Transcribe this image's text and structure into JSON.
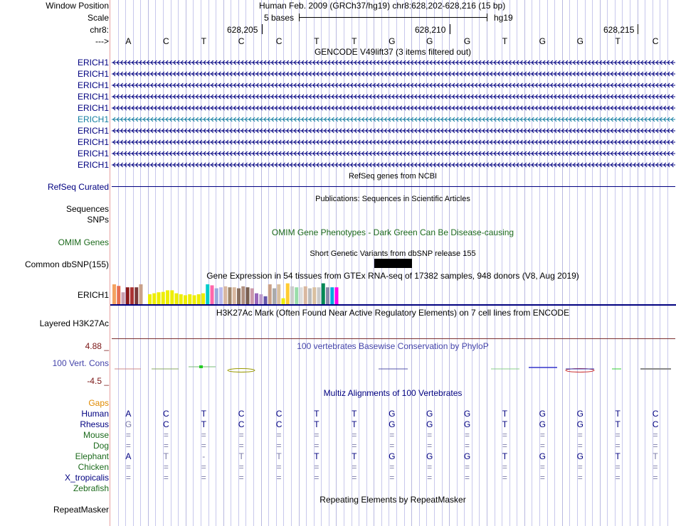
{
  "header": {
    "window_position_label": "Window Position",
    "window_position_value": "Human Feb. 2009 (GRCh37/hg19)   chr8:628,202-628,216 (15 bp)",
    "scale_label": "Scale",
    "scale_bases": "5 bases",
    "scale_assembly": "hg19",
    "chrom_label": "chr8:",
    "arrow_label": "--->",
    "positions": [
      "628,205",
      "628,210",
      "628,215"
    ]
  },
  "sequence": [
    "A",
    "C",
    "T",
    "C",
    "C",
    "T",
    "T",
    "G",
    "G",
    "G",
    "T",
    "G",
    "G",
    "T",
    "C"
  ],
  "gencode": {
    "title": "GENCODE V49lift37 (3 items filtered out)",
    "items": [
      {
        "label": "ERICH1",
        "highlight": false
      },
      {
        "label": "ERICH1",
        "highlight": false
      },
      {
        "label": "ERICH1",
        "highlight": false
      },
      {
        "label": "ERICH1",
        "highlight": false
      },
      {
        "label": "ERICH1",
        "highlight": false
      },
      {
        "label": "ERICH1",
        "highlight": true
      },
      {
        "label": "ERICH1",
        "highlight": false
      },
      {
        "label": "ERICH1",
        "highlight": false
      },
      {
        "label": "ERICH1",
        "highlight": false
      },
      {
        "label": "ERICH1",
        "highlight": false
      }
    ]
  },
  "refseq": {
    "title": "RefSeq genes from NCBI",
    "label": "RefSeq Curated"
  },
  "publications": {
    "title": "Publications: Sequences in Scientific Articles",
    "label1": "Sequences",
    "label2": "SNPs"
  },
  "omim": {
    "title": "OMIM Gene Phenotypes - Dark Green Can Be Disease-causing",
    "label": "OMIM Genes"
  },
  "dbsnp": {
    "title": "Short Genetic Variants from dbSNP release 155",
    "label": "Common dbSNP(155)"
  },
  "gtex": {
    "title": "Gene Expression in 54 tissues from GTEx RNA-seq of 17382 samples, 948 donors (V8, Aug 2019)",
    "label": "ERICH1",
    "bars": [
      {
        "color": "#f4a261",
        "level": 1.0
      },
      {
        "color": "#e76f51",
        "level": 0.92
      },
      {
        "color": "#c9a0b0",
        "level": 0.6
      },
      {
        "color": "#8b1a1a",
        "level": 0.85
      },
      {
        "color": "#aa3333",
        "level": 0.85
      },
      {
        "color": "#7b3a3a",
        "level": 0.85
      },
      {
        "color": "#c9a089",
        "level": 1.0
      },
      {
        "color": "#ffffff",
        "level": 0.1
      },
      {
        "color": "#eeee00",
        "level": 0.5
      },
      {
        "color": "#eeee00",
        "level": 0.55
      },
      {
        "color": "#eeee00",
        "level": 0.6
      },
      {
        "color": "#eeee00",
        "level": 0.62
      },
      {
        "color": "#eeee00",
        "level": 0.7
      },
      {
        "color": "#eeee00",
        "level": 0.7
      },
      {
        "color": "#eeee00",
        "level": 0.55
      },
      {
        "color": "#eeee00",
        "level": 0.5
      },
      {
        "color": "#eeee00",
        "level": 0.45
      },
      {
        "color": "#eeee00",
        "level": 0.5
      },
      {
        "color": "#eeee00",
        "level": 0.45
      },
      {
        "color": "#eeee00",
        "level": 0.5
      },
      {
        "color": "#eeee00",
        "level": 0.55
      },
      {
        "color": "#00cccc",
        "level": 1.0
      },
      {
        "color": "#ff66aa",
        "level": 0.95
      },
      {
        "color": "#99aadd",
        "level": 0.8
      },
      {
        "color": "#bbbbee",
        "level": 0.85
      },
      {
        "color": "#d9b8a0",
        "level": 0.9
      },
      {
        "color": "#a0866a",
        "level": 0.85
      },
      {
        "color": "#d9b8a0",
        "level": 0.85
      },
      {
        "color": "#8a7060",
        "level": 0.8
      },
      {
        "color": "#b09080",
        "level": 0.9
      },
      {
        "color": "#7a6050",
        "level": 0.85
      },
      {
        "color": "#cc99aa",
        "level": 0.8
      },
      {
        "color": "#9966bb",
        "level": 0.55
      },
      {
        "color": "#bb99cc",
        "level": 0.5
      },
      {
        "color": "#6655aa",
        "level": 0.4
      },
      {
        "color": "#c9a089",
        "level": 1.0
      },
      {
        "color": "#aaaaaa",
        "level": 0.8
      },
      {
        "color": "#d9c0a0",
        "level": 1.0
      },
      {
        "color": "#eeee00",
        "level": 0.3
      },
      {
        "color": "#ffcc33",
        "level": 1.05
      },
      {
        "color": "#cccccc",
        "level": 0.9
      },
      {
        "color": "#99ddaa",
        "level": 0.85
      },
      {
        "color": "#dddddd",
        "level": 0.85
      },
      {
        "color": "#d9b8a0",
        "level": 0.9
      },
      {
        "color": "#bbbbbb",
        "level": 0.8
      },
      {
        "color": "#d9c0a0",
        "level": 0.85
      },
      {
        "color": "#c9c9c9",
        "level": 0.85
      },
      {
        "color": "#008855",
        "level": 1.05
      },
      {
        "color": "#8888aa",
        "level": 0.85
      },
      {
        "color": "#00aadd",
        "level": 0.85
      },
      {
        "color": "#ff00ee",
        "level": 0.85
      }
    ]
  },
  "h3k27ac": {
    "title": "H3K27Ac Mark (Often Found Near Active Regulatory Elements) on 7 cell lines from ENCODE",
    "label": "Layered H3K27Ac"
  },
  "cons": {
    "title": "100 vertebrates Basewise Conservation by PhyloP",
    "label": "100 Vert. Cons",
    "max": "4.88 _",
    "min": "-4.5 _"
  },
  "multiz": {
    "title": "Multiz Alignments of 100 Vertebrates",
    "gaps_label": "Gaps",
    "species": [
      {
        "name": "Human",
        "color": "#000080",
        "bases": [
          "A",
          "C",
          "T",
          "C",
          "C",
          "T",
          "T",
          "G",
          "G",
          "G",
          "T",
          "G",
          "G",
          "T",
          "C"
        ],
        "grey": []
      },
      {
        "name": "Rhesus",
        "color": "#000080",
        "bases": [
          "G",
          "C",
          "T",
          "C",
          "C",
          "T",
          "T",
          "G",
          "G",
          "G",
          "T",
          "G",
          "G",
          "T",
          "C"
        ],
        "grey": [
          0
        ]
      },
      {
        "name": "Mouse",
        "color": "#1c6a1c",
        "bases": [
          "=",
          "=",
          "=",
          "=",
          "=",
          "=",
          "=",
          "=",
          "=",
          "=",
          "=",
          "=",
          "=",
          "=",
          "="
        ],
        "grey": "all"
      },
      {
        "name": "Dog",
        "color": "#1c6a1c",
        "bases": [
          "=",
          "=",
          "=",
          "=",
          "=",
          "=",
          "=",
          "=",
          "=",
          "=",
          "=",
          "=",
          "=",
          "=",
          "="
        ],
        "grey": "all"
      },
      {
        "name": "Elephant",
        "color": "#1c6a1c",
        "bases": [
          "A",
          "T",
          "-",
          "T",
          "T",
          "T",
          "T",
          "G",
          "G",
          "G",
          "T",
          "G",
          "G",
          "T",
          "T"
        ],
        "grey": [
          1,
          2,
          3,
          4,
          14
        ]
      },
      {
        "name": "Chicken",
        "color": "#1c6a1c",
        "bases": [
          "=",
          "=",
          "=",
          "=",
          "=",
          "=",
          "=",
          "=",
          "=",
          "=",
          "=",
          "=",
          "=",
          "=",
          "="
        ],
        "grey": "all"
      },
      {
        "name": "X_tropicalis",
        "color": "#000080",
        "bases": [
          "=",
          "=",
          "=",
          "=",
          "=",
          "=",
          "=",
          "=",
          "=",
          "=",
          "=",
          "=",
          "=",
          "=",
          "="
        ],
        "grey": "all"
      },
      {
        "name": "Zebrafish",
        "color": "#1c6a1c",
        "bases": [],
        "grey": []
      }
    ]
  },
  "repeatmasker": {
    "title": "Repeating Elements by RepeatMasker",
    "label": "RepeatMasker"
  }
}
